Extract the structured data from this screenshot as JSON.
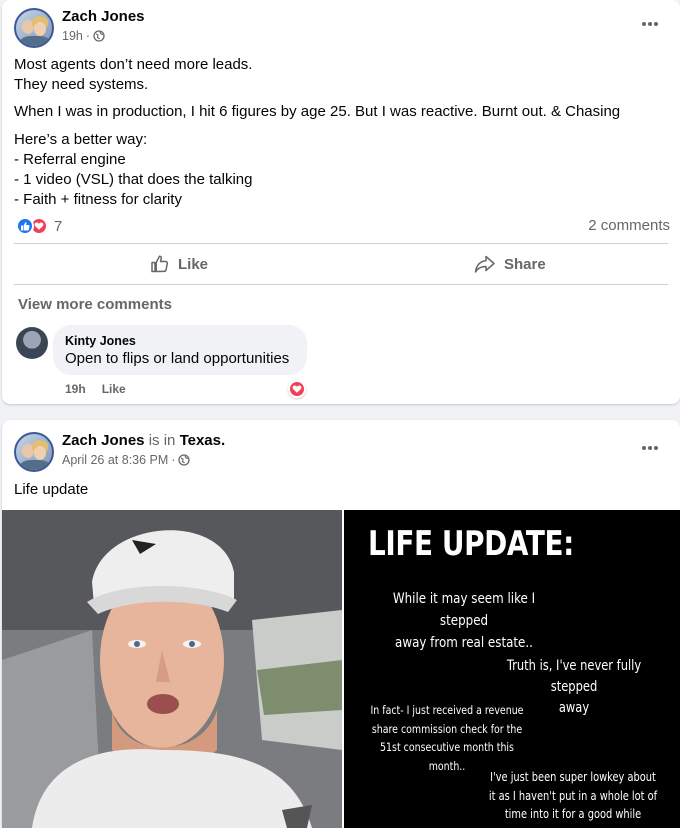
{
  "post1": {
    "author": "Zach Jones",
    "time": "19h",
    "lines": [
      "Most agents don’t need more leads.",
      "They need systems.",
      "When I was in production, I hit 6 figures by age 25. But I was reactive. Burnt out. & Chasing",
      "Here’s a better way:",
      "- Referral engine",
      "- 1 video (VSL) that does the talking",
      "- Faith + fitness for clarity"
    ],
    "reaction_count": "7",
    "comments_count": "2 comments",
    "like_label": "Like",
    "share_label": "Share",
    "view_more": "View more comments",
    "comment": {
      "author": "Kinty Jones",
      "text": "Open to flips or land opportunities",
      "time": "19h",
      "like": "Like"
    }
  },
  "post2": {
    "author": "Zach Jones",
    "is_in": "is in",
    "location": "Texas.",
    "time": "April 26 at 8:36 PM",
    "text": "Life update",
    "image_text": {
      "title": "LIFE UPDATE:",
      "p1a": "While it may seem like I stepped",
      "p1b": "away from real estate..",
      "p2a": "Truth is, I've never fully stepped",
      "p2b": "away",
      "p3a": "In fact- I just received a revenue",
      "p3b": "share commission check for the",
      "p3c": "51st consecutive month this",
      "p3d": "month..",
      "p4a": "I've just been super lowkey about",
      "p4b": "it as I haven't put in a whole lot of",
      "p4c": "time into it for a good while"
    }
  },
  "colors": {
    "like_blue": "#1877f2",
    "love_red": "#f33e58",
    "muted": "#65676b"
  }
}
